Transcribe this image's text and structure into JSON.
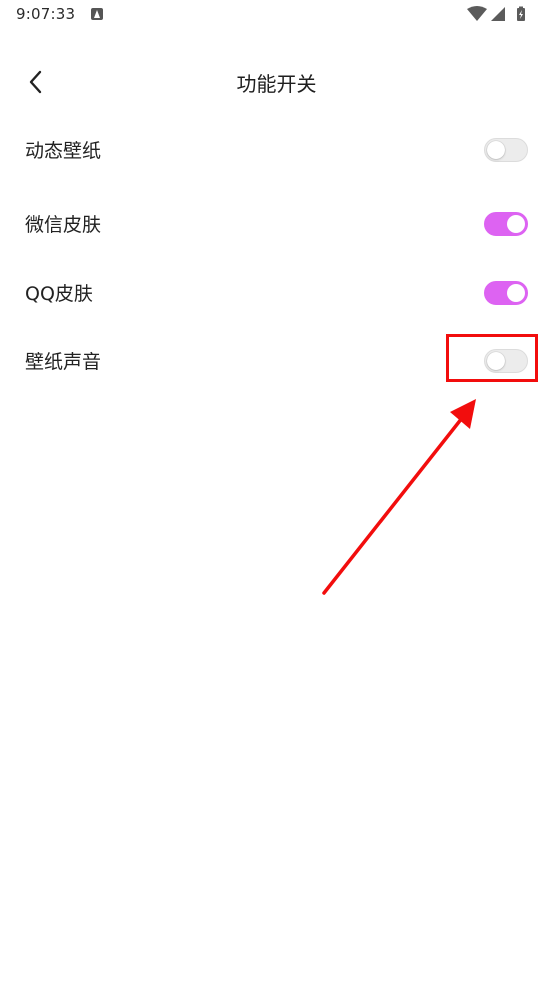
{
  "status_bar": {
    "time": "9:07:33",
    "icons": [
      "text-notification-icon",
      "wifi-icon",
      "signal-icon",
      "battery-charging-icon"
    ]
  },
  "header": {
    "back_icon": "chevron-left-icon",
    "title": "功能开关"
  },
  "settings": [
    {
      "label": "动态壁纸",
      "enabled": false
    },
    {
      "label": "微信皮肤",
      "enabled": true
    },
    {
      "label": "QQ皮肤",
      "enabled": true
    },
    {
      "label": "壁纸声音",
      "enabled": false
    }
  ],
  "colors": {
    "toggle_on": "#dd63f2",
    "toggle_off": "#ececec",
    "annotation": "#f20d0d"
  }
}
